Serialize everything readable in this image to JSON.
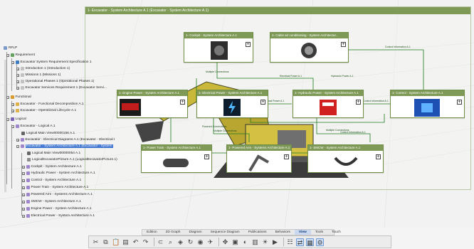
{
  "frame": {
    "title": "1- Excavator - System Architecture A.1 (Excavator - System Architecture A.1)"
  },
  "blocks": {
    "cockpit": "1- Cockpit - System Architecture A.1",
    "cabin": "1- Cabin air conditioning - System Architectur...",
    "engine": "1- Engine Power - System Architecture A.1",
    "electrical": "1- Electrical Power - System Architecture A.1",
    "hydraulic": "1- Hydraulic Power - System Architecture A.1",
    "control": "1- Control - System Architecture A.1",
    "powertrain": "1- Power Train - System Architecture A.1",
    "powered_arm": "1- Powered Arm - Systems Architecture A.1",
    "smcw": "1- SMCW - System Architecture A.1"
  },
  "connections": {
    "multiple1": "Multiple Connections",
    "control_info1": "Control Information A.1",
    "electrical_power": "Electrical Power A.1",
    "electrical_power2": "Electrical Power A.1",
    "hydraulic_power": "Hydraulic Power A.1",
    "control_info2": "Control Information A.1",
    "control_info3": "Control Information A.1",
    "multiple2": "Multiple Connections",
    "multiple3": "Multiple Connections",
    "power_train_conn": "Powered Connections"
  },
  "tree": {
    "root": "RFLP",
    "requirement": "Requirement",
    "spec": "Excavator System Requirement Specification 1",
    "intro": "Introduction 1 (Introduction 1)",
    "missions": "Missions 1 (Missions 1)",
    "phases": "Operational Phases 1 (Operational Phases 1)",
    "services": "Excavator Services Requirement 1 (Excavator Servi...",
    "functional": "Functional",
    "func_decomp": "Excavator - Functional Decomposition A.1",
    "op_lifecycle": "Excavator - Operational Lifecycle A.1",
    "logical": "Logical",
    "exc_logical": "Excavator - Logical A.1",
    "main_view1": "Logical Main View00000156 A.1",
    "elec_diag": "Excavator - Electrical Diagrams A.1 (Excavator - Electrical I",
    "sys_arch": "Excavator - System Architecture A.1 (Excavator - System",
    "main_view2": "Logical Main View00000054 A.1",
    "logical_pic": "LogicalExcavatorPicture A.1 (LogicalExcavatorPicture.1)",
    "cockpit": "Cockpit - System Architecture A.1",
    "hydraulic": "Hydraulic Power - System Architecture A.1",
    "control": "Control - System Architecture A.1",
    "power_train": "Power Train - System Architecture A.1",
    "powered_arm": "Powered Arm - Systems Architecture A.1",
    "smcw": "SMCW - System Architecture A.1",
    "engine": "Engine Power - System Architecture A.1",
    "electrical": "Electrical Power - System Architecture A.1"
  },
  "tabs": [
    "Edition",
    "2D Graph",
    "Diagram",
    "Sequence Diagram",
    "Publications",
    "Behaviors",
    "View",
    "Tools",
    "Touch"
  ],
  "active_tab": "View",
  "toolbar_icons": [
    "cut-icon",
    "copy-icon",
    "paste-icon",
    "delete-icon",
    "undo-icon",
    "redo-icon",
    "magnet-icon",
    "zoom-icon",
    "cube-icon",
    "rotate-icon",
    "look-at-icon",
    "fly-icon",
    "pan-icon",
    "view-icon",
    "render-icon",
    "display-icon",
    "lamp-icon",
    "play-icon",
    "layout-icon",
    "connector-icon",
    "diagram-icon",
    "network-icon"
  ],
  "colors": {
    "block_header": "#7f9a57",
    "connector": "#1f7a1f",
    "selection": "#3f76d0"
  }
}
